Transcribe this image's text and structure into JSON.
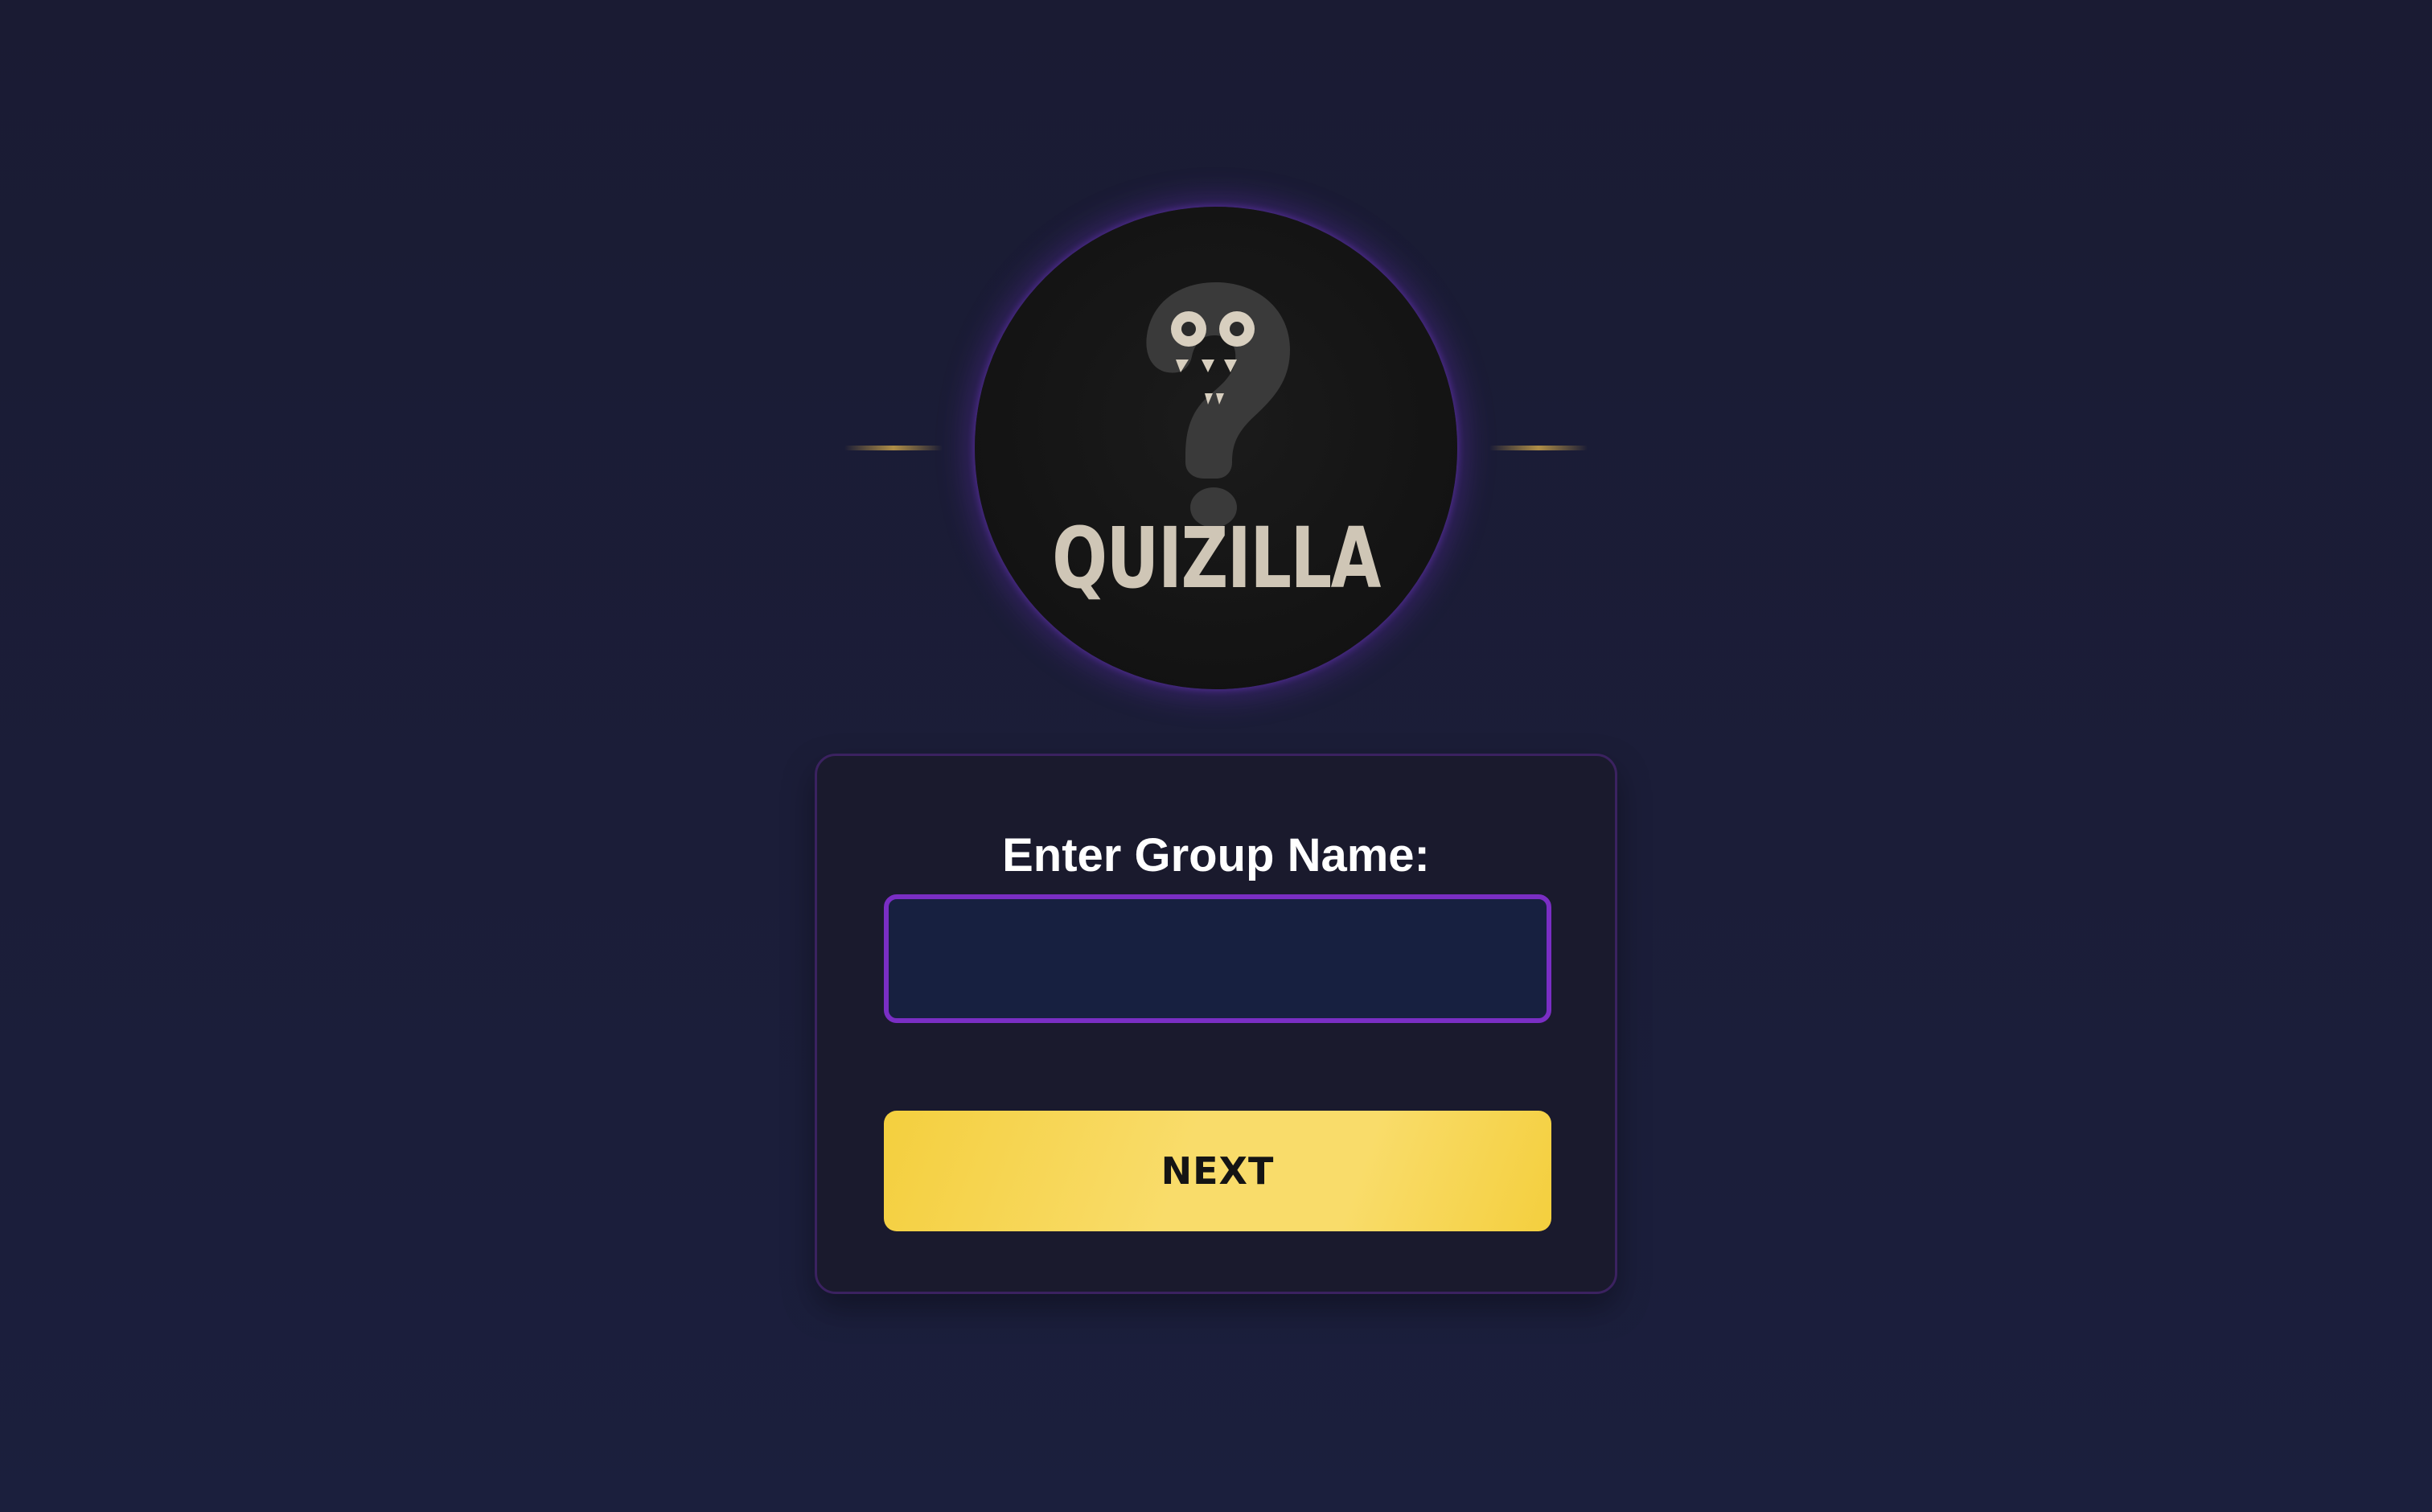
{
  "logo": {
    "text": "QUIZILLA",
    "icon": "question-mark-monster-icon"
  },
  "form": {
    "label": "Enter Group Name:",
    "group_name_value": "",
    "group_name_placeholder": "",
    "next_label": "NEXT"
  },
  "colors": {
    "background": "#1a1b33",
    "card_background": "#1a1a2d",
    "card_border": "#3b2260",
    "input_background": "#172040",
    "input_border": "#7a2ec4",
    "button": "#f7d654",
    "logo_glow": "#7032c8",
    "accent_lines": "#c9a24a",
    "logo_text": "#cfc6b6"
  }
}
